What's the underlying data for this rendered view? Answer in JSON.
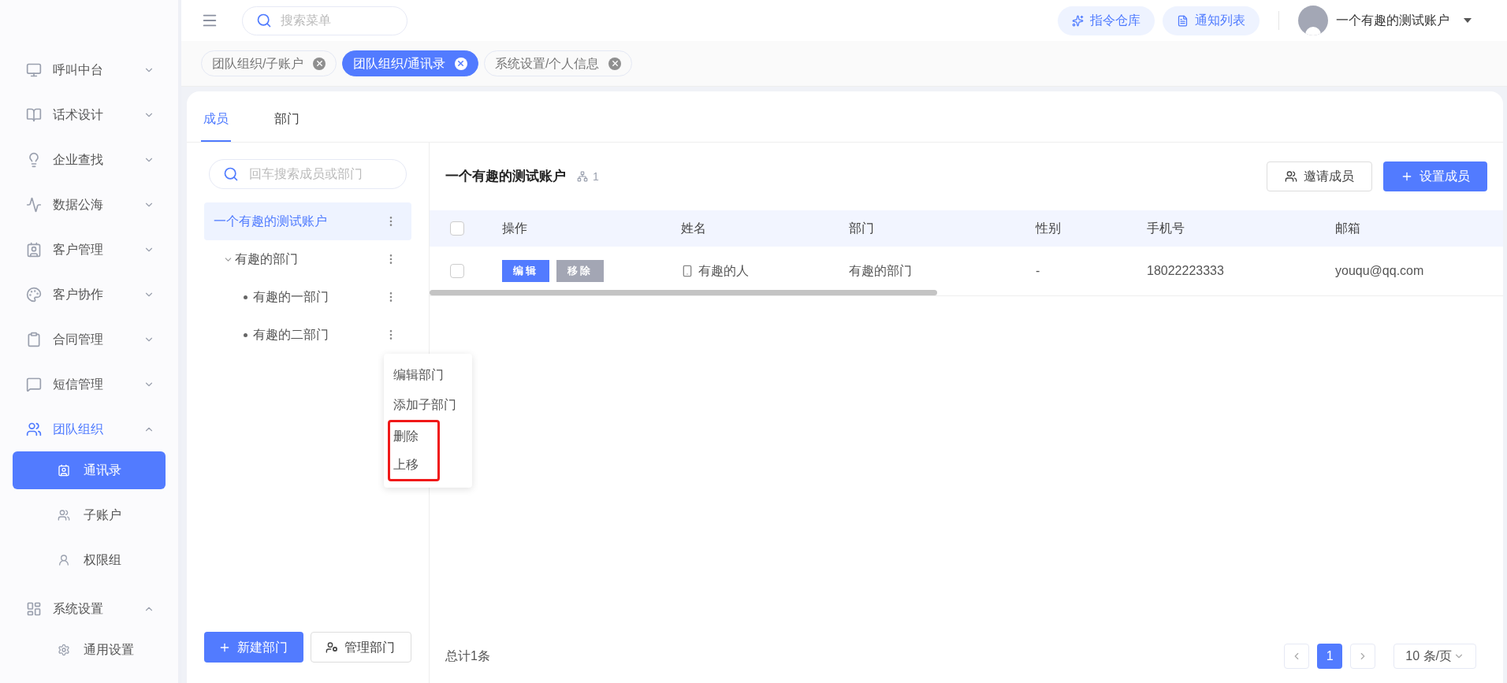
{
  "sidebar": {
    "items": [
      {
        "label": "呼叫中台",
        "expanded": false,
        "selected": false
      },
      {
        "label": "话术设计",
        "expanded": false,
        "selected": false
      },
      {
        "label": "企业查找",
        "expanded": false,
        "selected": false
      },
      {
        "label": "数据公海",
        "expanded": false,
        "selected": false
      },
      {
        "label": "客户管理",
        "expanded": false,
        "selected": false
      },
      {
        "label": "客户协作",
        "expanded": false,
        "selected": false
      },
      {
        "label": "合同管理",
        "expanded": false,
        "selected": false
      },
      {
        "label": "短信管理",
        "expanded": false,
        "selected": false
      },
      {
        "label": "团队组织",
        "expanded": true,
        "selected": true,
        "children": [
          {
            "label": "通讯录",
            "selected": true
          },
          {
            "label": "子账户",
            "selected": false
          },
          {
            "label": "权限组",
            "selected": false
          }
        ]
      },
      {
        "label": "系统设置",
        "expanded": true,
        "selected": false,
        "children": [
          {
            "label": "通用设置",
            "selected": false
          }
        ]
      }
    ]
  },
  "header": {
    "search": {
      "placeholder": "搜索菜单"
    },
    "buttons": [
      "指令仓库",
      "通知列表"
    ],
    "user": "一个有趣的测试账户"
  },
  "page_tabs": [
    {
      "label": "团队组织/子账户",
      "selected": false
    },
    {
      "label": "团队组织/通讯录",
      "selected": true
    },
    {
      "label": "系统设置/个人信息",
      "selected": false
    }
  ],
  "tabs": [
    {
      "label": "成员",
      "selected": true
    },
    {
      "label": "部门",
      "selected": false
    }
  ],
  "tree": {
    "search": {
      "placeholder": "回车搜索成员或部门"
    },
    "nodes": [
      {
        "label": "一个有趣的测试账户",
        "selected": true,
        "children": [
          {
            "label": "有趣的部门",
            "selected": false,
            "expanded": true,
            "children": [
              {
                "label": "有趣的一部门",
                "selected": false
              },
              {
                "label": "有趣的二部门",
                "selected": false
              }
            ]
          }
        ]
      }
    ],
    "buttons": [
      "新建部门",
      "管理部门"
    ]
  },
  "context_menu": {
    "items": [
      {
        "label": "编辑部门",
        "highlighted": false
      },
      {
        "label": "添加子部门",
        "highlighted": false
      },
      {
        "label": "删除",
        "highlighted": true
      },
      {
        "label": "上移",
        "highlighted": true
      }
    ]
  },
  "members": {
    "title": "一个有趣的测试账户",
    "count": "1",
    "buttons": [
      "邀请成员",
      "设置成员"
    ],
    "table": {
      "header_checked": false,
      "columns": [
        "操作",
        "姓名",
        "部门",
        "性别",
        "手机号",
        "邮箱"
      ],
      "rows": [
        {
          "checked": false,
          "actions": [
            "编辑",
            "移除"
          ],
          "name": "有趣的人",
          "department": "有趣的部门",
          "gender": "-",
          "phone": "18022223333",
          "email": "youqu@qq.com"
        }
      ]
    },
    "footer": {
      "total": "总计1条",
      "pages": [
        {
          "label": "1",
          "selected": true
        }
      ],
      "page_size": "10 条/页"
    }
  }
}
